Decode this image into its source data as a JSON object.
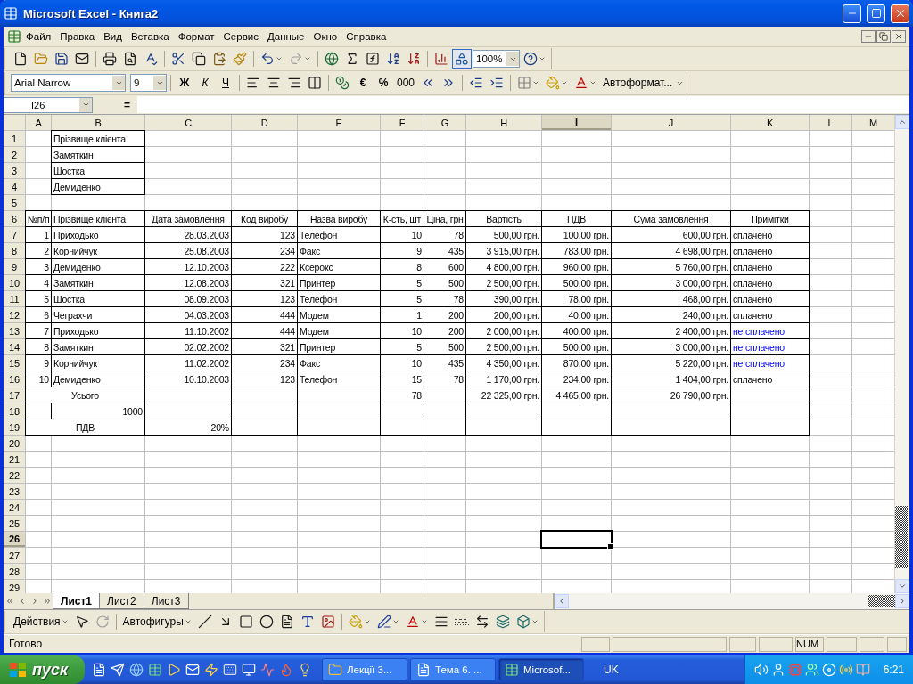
{
  "window": {
    "title": "Microsoft Excel - Книга2"
  },
  "menu": [
    "Файл",
    "Правка",
    "Вид",
    "Вставка",
    "Формат",
    "Сервис",
    "Данные",
    "Окно",
    "Справка"
  ],
  "standard_toolbar": {
    "zoom": "100%",
    "drawing_toggle": {
      "on": true
    }
  },
  "formatting_toolbar": {
    "font": "Arial Narrow",
    "size": "9",
    "style_buttons": [
      "Ж",
      "К",
      "Ч"
    ],
    "currency": "€",
    "percent": "%",
    "thousands": "000",
    "autoformat": "Автоформат..."
  },
  "formula_bar": {
    "name_box": "I26",
    "equals": "="
  },
  "sheet": {
    "columns": [
      {
        "label": "A",
        "selected": false
      },
      {
        "label": "B",
        "selected": false
      },
      {
        "label": "C",
        "selected": false
      },
      {
        "label": "D",
        "selected": false
      },
      {
        "label": "E",
        "selected": false
      },
      {
        "label": "F",
        "selected": false
      },
      {
        "label": "G",
        "selected": false
      },
      {
        "label": "H",
        "selected": false
      },
      {
        "label": "I",
        "selected": true
      },
      {
        "label": "J",
        "selected": false
      },
      {
        "label": "K",
        "selected": false
      },
      {
        "label": "L",
        "selected": false
      },
      {
        "label": "M",
        "selected": false
      }
    ],
    "rows": [
      {
        "header": "1",
        "selected": false,
        "cells": [
          null,
          {
            "text": "Прізвище клієнта",
            "kind": "text",
            "boxed": true
          },
          null,
          null,
          null,
          null,
          null,
          null,
          null,
          null,
          null,
          null,
          null
        ]
      },
      {
        "header": "2",
        "selected": false,
        "cells": [
          null,
          {
            "text": "Замяткин",
            "kind": "text",
            "boxed": true
          },
          null,
          null,
          null,
          null,
          null,
          null,
          null,
          null,
          null,
          null,
          null
        ]
      },
      {
        "header": "3",
        "selected": false,
        "cells": [
          null,
          {
            "text": "Шостка",
            "kind": "text",
            "boxed": true
          },
          null,
          null,
          null,
          null,
          null,
          null,
          null,
          null,
          null,
          null,
          null
        ]
      },
      {
        "header": "4",
        "selected": false,
        "cells": [
          null,
          {
            "text": "Демиденко",
            "kind": "text",
            "boxed": true
          },
          null,
          null,
          null,
          null,
          null,
          null,
          null,
          null,
          null,
          null,
          null
        ]
      },
      {
        "header": "5",
        "selected": false
      },
      {
        "header": "6",
        "selected": false,
        "cells": [
          {
            "text": "№п/п",
            "kind": "heading",
            "boxed": true
          },
          {
            "text": "Прізвище клієнта",
            "kind": "text",
            "boxed": true
          },
          {
            "text": "Дата замовлення",
            "kind": "heading",
            "boxed": true
          },
          {
            "text": "Код виробу",
            "kind": "heading",
            "boxed": true
          },
          {
            "text": "Назва виробу",
            "kind": "heading",
            "boxed": true
          },
          {
            "text": "К-сть, шт",
            "kind": "heading",
            "boxed": true
          },
          {
            "text": "Ціна, грн",
            "kind": "heading",
            "boxed": true
          },
          {
            "text": "Вартість",
            "kind": "heading",
            "boxed": true
          },
          {
            "text": "ПДВ",
            "kind": "heading",
            "boxed": true
          },
          {
            "text": "Сума замовлення",
            "kind": "heading",
            "boxed": true
          },
          {
            "text": "Примітки",
            "kind": "heading",
            "boxed": true
          },
          null,
          null
        ]
      },
      {
        "header": "7",
        "selected": false,
        "cells": [
          {
            "text": "1",
            "kind": "number",
            "boxed": true
          },
          {
            "text": "Приходько",
            "kind": "text",
            "boxed": true
          },
          {
            "text": "28.03.2003",
            "kind": "number",
            "boxed": true
          },
          {
            "text": "123",
            "kind": "number",
            "boxed": true
          },
          {
            "text": "Телефон",
            "kind": "text",
            "boxed": true
          },
          {
            "text": "10",
            "kind": "number",
            "boxed": true
          },
          {
            "text": "78",
            "kind": "number",
            "boxed": true
          },
          {
            "text": "500,00 грн.",
            "kind": "number",
            "boxed": true
          },
          {
            "text": "100,00 грн.",
            "kind": "number",
            "boxed": true
          },
          {
            "text": "600,00 грн.",
            "kind": "number",
            "boxed": true
          },
          {
            "text": "сплачено",
            "kind": "text",
            "boxed": true
          },
          null,
          null
        ]
      },
      {
        "header": "8",
        "selected": false,
        "cells": [
          {
            "text": "2",
            "kind": "number",
            "boxed": true
          },
          {
            "text": "Корнийчук",
            "kind": "text",
            "boxed": true
          },
          {
            "text": "25.08.2003",
            "kind": "number",
            "boxed": true
          },
          {
            "text": "234",
            "kind": "number",
            "boxed": true
          },
          {
            "text": "Факс",
            "kind": "text",
            "boxed": true
          },
          {
            "text": "9",
            "kind": "number",
            "boxed": true
          },
          {
            "text": "435",
            "kind": "number",
            "boxed": true
          },
          {
            "text": "3 915,00 грн.",
            "kind": "number",
            "boxed": true
          },
          {
            "text": "783,00 грн.",
            "kind": "number",
            "boxed": true
          },
          {
            "text": "4 698,00 грн.",
            "kind": "number",
            "boxed": true
          },
          {
            "text": "сплачено",
            "kind": "text",
            "boxed": true
          },
          null,
          null
        ]
      },
      {
        "header": "9",
        "selected": false,
        "cells": [
          {
            "text": "3",
            "kind": "number",
            "boxed": true
          },
          {
            "text": "Демиденко",
            "kind": "text",
            "boxed": true
          },
          {
            "text": "12.10.2003",
            "kind": "number",
            "boxed": true
          },
          {
            "text": "222",
            "kind": "number",
            "boxed": true
          },
          {
            "text": "Ксерокс",
            "kind": "text",
            "boxed": true
          },
          {
            "text": "8",
            "kind": "number",
            "boxed": true
          },
          {
            "text": "600",
            "kind": "number",
            "boxed": true
          },
          {
            "text": "4 800,00 грн.",
            "kind": "number",
            "boxed": true
          },
          {
            "text": "960,00 грн.",
            "kind": "number",
            "boxed": true
          },
          {
            "text": "5 760,00 грн.",
            "kind": "number",
            "boxed": true
          },
          {
            "text": "сплачено",
            "kind": "text",
            "boxed": true
          },
          null,
          null
        ]
      },
      {
        "header": "10",
        "selected": false,
        "cells": [
          {
            "text": "4",
            "kind": "number",
            "boxed": true
          },
          {
            "text": "Замяткин",
            "kind": "text",
            "boxed": true
          },
          {
            "text": "12.08.2003",
            "kind": "number",
            "boxed": true
          },
          {
            "text": "321",
            "kind": "number",
            "boxed": true
          },
          {
            "text": "Принтер",
            "kind": "text",
            "boxed": true
          },
          {
            "text": "5",
            "kind": "number",
            "boxed": true
          },
          {
            "text": "500",
            "kind": "number",
            "boxed": true
          },
          {
            "text": "2 500,00 грн.",
            "kind": "number",
            "boxed": true
          },
          {
            "text": "500,00 грн.",
            "kind": "number",
            "boxed": true
          },
          {
            "text": "3 000,00 грн.",
            "kind": "number",
            "boxed": true
          },
          {
            "text": "сплачено",
            "kind": "text",
            "boxed": true
          },
          null,
          null
        ]
      },
      {
        "header": "11",
        "selected": false,
        "cells": [
          {
            "text": "5",
            "kind": "number",
            "boxed": true
          },
          {
            "text": "Шостка",
            "kind": "text",
            "boxed": true
          },
          {
            "text": "08.09.2003",
            "kind": "number",
            "boxed": true
          },
          {
            "text": "123",
            "kind": "number",
            "boxed": true
          },
          {
            "text": "Телефон",
            "kind": "text",
            "boxed": true
          },
          {
            "text": "5",
            "kind": "number",
            "boxed": true
          },
          {
            "text": "78",
            "kind": "number",
            "boxed": true
          },
          {
            "text": "390,00 грн.",
            "kind": "number",
            "boxed": true
          },
          {
            "text": "78,00 грн.",
            "kind": "number",
            "boxed": true
          },
          {
            "text": "468,00 грн.",
            "kind": "number",
            "boxed": true
          },
          {
            "text": "сплачено",
            "kind": "text",
            "boxed": true
          },
          null,
          null
        ]
      },
      {
        "header": "12",
        "selected": false,
        "cells": [
          {
            "text": "6",
            "kind": "number",
            "boxed": true
          },
          {
            "text": "Чеграхчи",
            "kind": "text",
            "boxed": true
          },
          {
            "text": "04.03.2003",
            "kind": "number",
            "boxed": true
          },
          {
            "text": "444",
            "kind": "number",
            "boxed": true
          },
          {
            "text": "Модем",
            "kind": "text",
            "boxed": true
          },
          {
            "text": "1",
            "kind": "number",
            "boxed": true
          },
          {
            "text": "200",
            "kind": "number",
            "boxed": true
          },
          {
            "text": "200,00 грн.",
            "kind": "number",
            "boxed": true
          },
          {
            "text": "40,00 грн.",
            "kind": "number",
            "boxed": true
          },
          {
            "text": "240,00 грн.",
            "kind": "number",
            "boxed": true
          },
          {
            "text": "сплачено",
            "kind": "text",
            "boxed": true
          },
          null,
          null
        ]
      },
      {
        "header": "13",
        "selected": false,
        "cells": [
          {
            "text": "7",
            "kind": "number",
            "boxed": true
          },
          {
            "text": "Приходько",
            "kind": "text",
            "boxed": true
          },
          {
            "text": "11.10.2002",
            "kind": "number",
            "boxed": true
          },
          {
            "text": "444",
            "kind": "number",
            "boxed": true
          },
          {
            "text": "Модем",
            "kind": "text",
            "boxed": true
          },
          {
            "text": "10",
            "kind": "number",
            "boxed": true
          },
          {
            "text": "200",
            "kind": "number",
            "boxed": true
          },
          {
            "text": "2 000,00 грн.",
            "kind": "number",
            "boxed": true
          },
          {
            "text": "400,00 грн.",
            "kind": "number",
            "boxed": true
          },
          {
            "text": "2 400,00 грн.",
            "kind": "number",
            "boxed": true
          },
          {
            "text": "не сплачено",
            "kind": "highlight",
            "boxed": true
          },
          null,
          null
        ]
      },
      {
        "header": "14",
        "selected": false,
        "cells": [
          {
            "text": "8",
            "kind": "number",
            "boxed": true
          },
          {
            "text": "Замяткин",
            "kind": "text",
            "boxed": true
          },
          {
            "text": "02.02.2002",
            "kind": "number",
            "boxed": true
          },
          {
            "text": "321",
            "kind": "number",
            "boxed": true
          },
          {
            "text": "Принтер",
            "kind": "text",
            "boxed": true
          },
          {
            "text": "5",
            "kind": "number",
            "boxed": true
          },
          {
            "text": "500",
            "kind": "number",
            "boxed": true
          },
          {
            "text": "2 500,00 грн.",
            "kind": "number",
            "boxed": true
          },
          {
            "text": "500,00 грн.",
            "kind": "number",
            "boxed": true
          },
          {
            "text": "3 000,00 грн.",
            "kind": "number",
            "boxed": true
          },
          {
            "text": "не сплачено",
            "kind": "highlight",
            "boxed": true
          },
          null,
          null
        ]
      },
      {
        "header": "15",
        "selected": false,
        "cells": [
          {
            "text": "9",
            "kind": "number",
            "boxed": true
          },
          {
            "text": "Корнийчук",
            "kind": "text",
            "boxed": true
          },
          {
            "text": "11.02.2002",
            "kind": "number",
            "boxed": true
          },
          {
            "text": "234",
            "kind": "number",
            "boxed": true
          },
          {
            "text": "Факс",
            "kind": "text",
            "boxed": true
          },
          {
            "text": "10",
            "kind": "number",
            "boxed": true
          },
          {
            "text": "435",
            "kind": "number",
            "boxed": true
          },
          {
            "text": "4 350,00 грн.",
            "kind": "number",
            "boxed": true
          },
          {
            "text": "870,00 грн.",
            "kind": "number",
            "boxed": true
          },
          {
            "text": "5 220,00 грн.",
            "kind": "number",
            "boxed": true
          },
          {
            "text": "не сплачено",
            "kind": "highlight",
            "boxed": true
          },
          null,
          null
        ]
      },
      {
        "header": "16",
        "selected": false,
        "cells": [
          {
            "text": "10",
            "kind": "number",
            "boxed": true
          },
          {
            "text": "Демиденко",
            "kind": "text",
            "boxed": true
          },
          {
            "text": "10.10.2003",
            "kind": "number",
            "boxed": true
          },
          {
            "text": "123",
            "kind": "number",
            "boxed": true
          },
          {
            "text": "Телефон",
            "kind": "text",
            "boxed": true
          },
          {
            "text": "15",
            "kind": "number",
            "boxed": true
          },
          {
            "text": "78",
            "kind": "number",
            "boxed": true
          },
          {
            "text": "1 170,00 грн.",
            "kind": "number",
            "boxed": true
          },
          {
            "text": "234,00 грн.",
            "kind": "number",
            "boxed": true
          },
          {
            "text": "1 404,00 грн.",
            "kind": "number",
            "boxed": true
          },
          {
            "text": "сплачено",
            "kind": "text",
            "boxed": true
          },
          null,
          null
        ]
      },
      {
        "header": "17",
        "selected": false,
        "cells": [
          {
            "text": "Усього",
            "kind": "heading",
            "boxed": true,
            "merged": true
          },
          {
            "boxed": true
          },
          {
            "boxed": true
          },
          {
            "boxed": true
          },
          {
            "text": "78",
            "kind": "number",
            "boxed": true
          },
          {
            "boxed": true
          },
          {
            "text": "22 325,00 грн.",
            "kind": "number",
            "boxed": true
          },
          {
            "text": "4 465,00 грн.",
            "kind": "number",
            "boxed": true
          },
          {
            "text": "26 790,00 грн.",
            "kind": "number",
            "boxed": true
          },
          {
            "boxed": true
          },
          null,
          null
        ]
      },
      {
        "header": "18",
        "selected": false,
        "cells": [
          {
            "boxed": true
          },
          {
            "text": "1000",
            "kind": "number",
            "boxed": true
          },
          {
            "boxed": true
          },
          {
            "boxed": true
          },
          {
            "boxed": true
          },
          {
            "boxed": true
          },
          {
            "boxed": true
          },
          {
            "boxed": true
          },
          {
            "boxed": true
          },
          {
            "boxed": true
          },
          {
            "boxed": true
          },
          null,
          null
        ]
      },
      {
        "header": "19",
        "selected": false,
        "cells": [
          {
            "text": "ПДВ",
            "kind": "heading",
            "boxed": true,
            "merged": true
          },
          {
            "text": "20%",
            "kind": "number",
            "boxed": true
          },
          {
            "boxed": true
          },
          {
            "boxed": true
          },
          {
            "boxed": true
          },
          {
            "boxed": true
          },
          {
            "boxed": true
          },
          {
            "boxed": true
          },
          {
            "boxed": true
          },
          {
            "boxed": true
          },
          null,
          null
        ]
      },
      {
        "header": "20",
        "selected": false
      },
      {
        "header": "21",
        "selected": false
      },
      {
        "header": "22",
        "selected": false
      },
      {
        "header": "23",
        "selected": false
      },
      {
        "header": "24",
        "selected": false
      },
      {
        "header": "25",
        "selected": false
      },
      {
        "header": "26",
        "selected": true
      },
      {
        "header": "27",
        "selected": false
      },
      {
        "header": "28",
        "selected": false
      },
      {
        "header": "29",
        "selected": false
      }
    ]
  },
  "sheet_tabs": [
    {
      "label": "Лист1",
      "selected": true
    },
    {
      "label": "Лист2",
      "selected": false
    },
    {
      "label": "Лист3",
      "selected": false
    }
  ],
  "drawing_toolbar": {
    "actions": "Действия",
    "autoshapes": "Автофигуры"
  },
  "status_bar": {
    "status": "Готово",
    "num": "NUM"
  },
  "taskbar": {
    "start": "пуск",
    "tasks": [
      {
        "label": "Лекції 3...",
        "kind": "folder",
        "selected": false
      },
      {
        "label": "Тема 6. ...",
        "kind": "document",
        "selected": false
      },
      {
        "label": "Microsof...",
        "kind": "spreadsheet",
        "selected": true
      }
    ],
    "language": "UK",
    "clock": "6:21"
  }
}
